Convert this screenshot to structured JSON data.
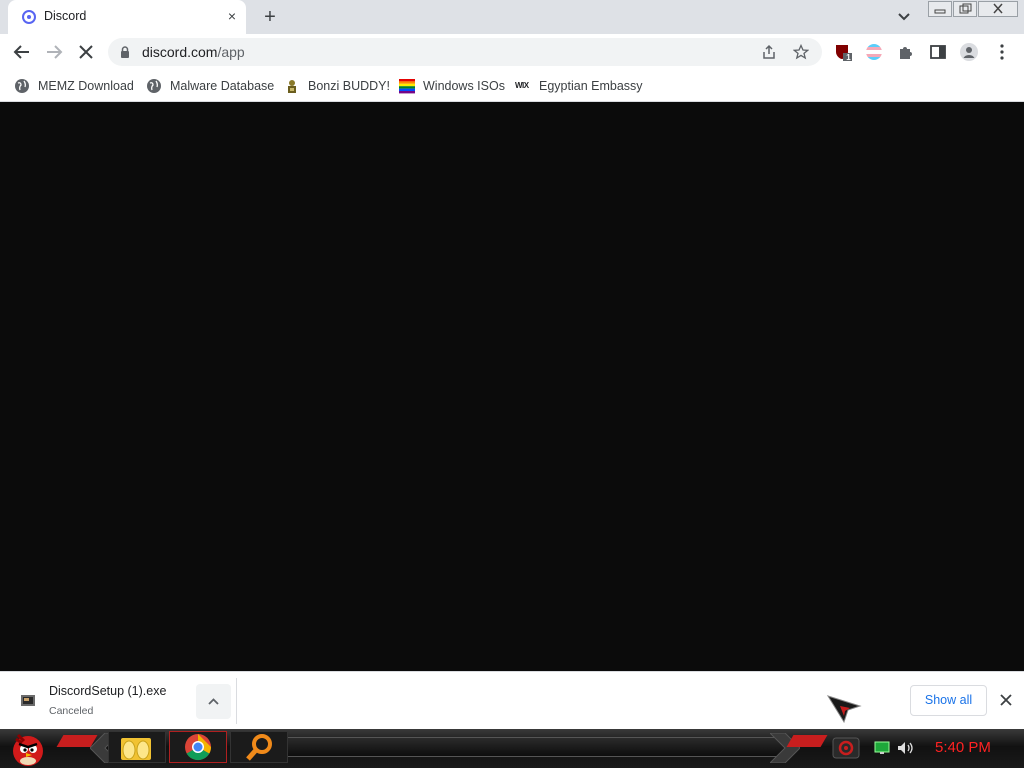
{
  "browser": {
    "tab": {
      "title": "Discord"
    },
    "new_tab_symbol": "+",
    "close_symbol": "×",
    "address": {
      "host": "discord.com",
      "path": "/app"
    },
    "extension_badge": "1"
  },
  "bookmarks": [
    {
      "label": "MEMZ Download",
      "icon": "globe-icon"
    },
    {
      "label": "Malware Database",
      "icon": "globe-icon"
    },
    {
      "label": "Bonzi BUDDY!",
      "icon": "bonzi-icon"
    },
    {
      "label": "Windows ISOs",
      "icon": "rainbow-flag-icon"
    },
    {
      "label": "Egyptian Embassy",
      "icon": "wix-icon",
      "icon_text": "WIX"
    }
  ],
  "download": {
    "filename": "DiscordSetup (1).exe",
    "status": "Canceled",
    "show_all_label": "Show all"
  },
  "taskbar": {
    "clock": "5:40 PM",
    "apps": [
      "explorer-icon",
      "chrome-icon",
      "search-icon"
    ]
  },
  "colors": {
    "content_bg": "#0b0b0b",
    "accent_blue": "#1a73e8",
    "taskbar_red": "#c81e1e",
    "clock_red": "#ff2222"
  }
}
